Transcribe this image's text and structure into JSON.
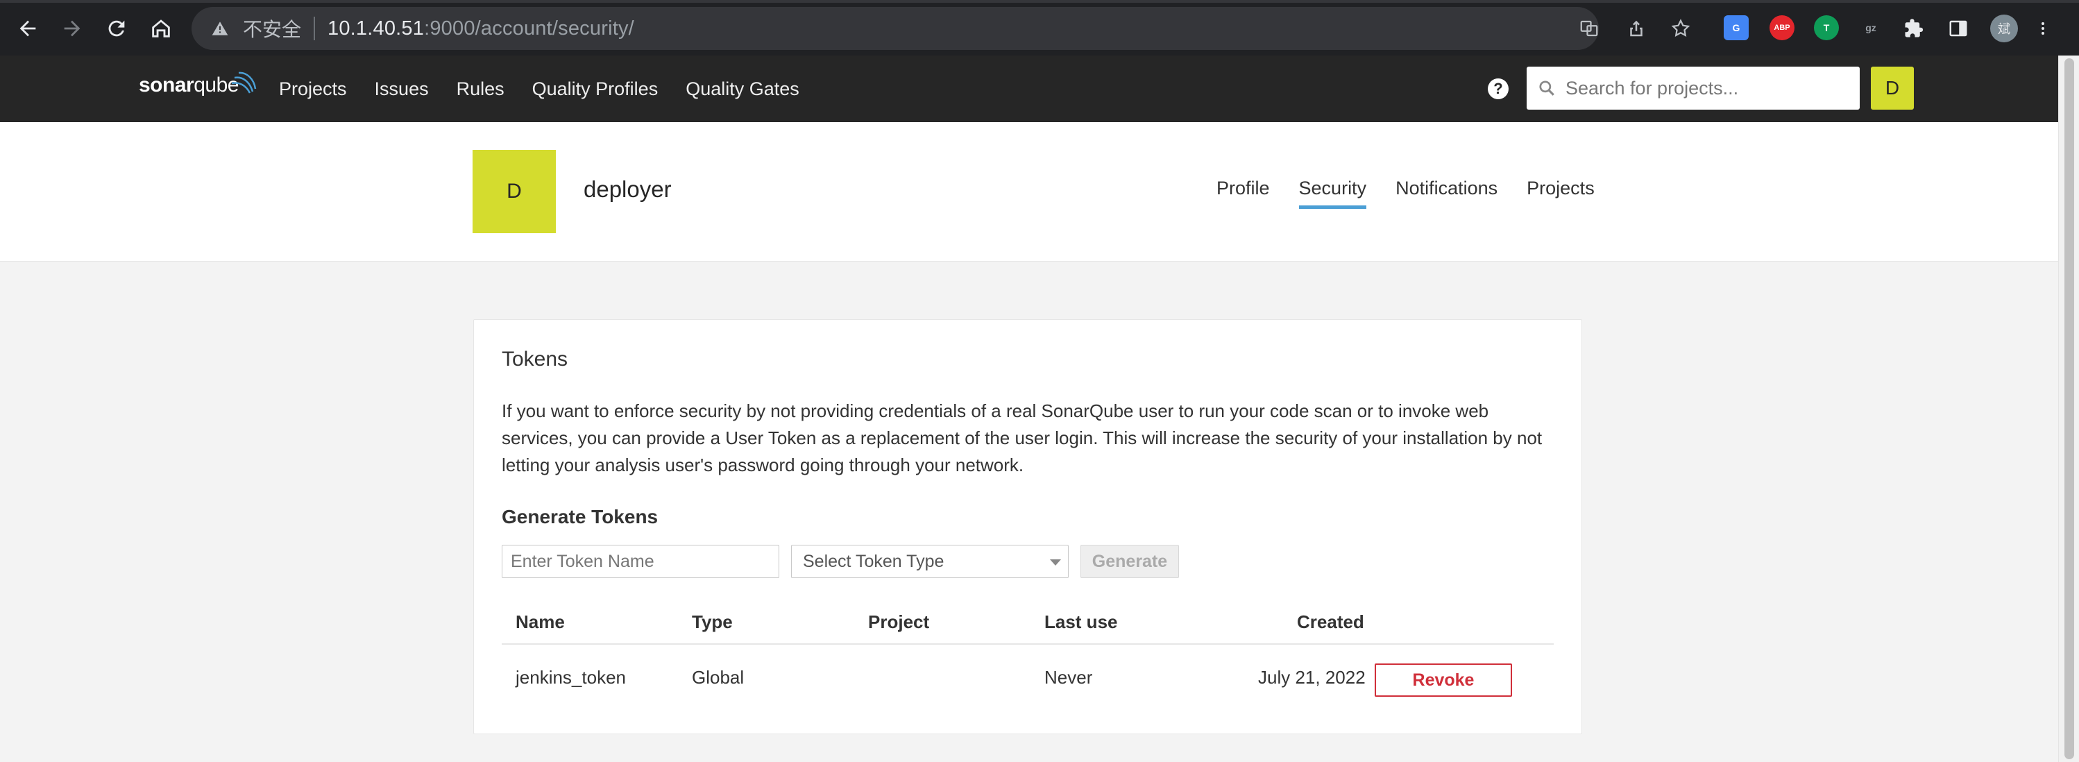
{
  "browser": {
    "insecure_label": "不安全",
    "url_host": "10.1.40.51",
    "url_rest": ":9000/account/security/",
    "profile_initial": "斌",
    "extensions": [
      {
        "name": "google-translate-icon",
        "label": "G",
        "color": "#4285f4"
      },
      {
        "name": "adblock-plus-icon",
        "label": "ABP",
        "color": "#e4262c"
      },
      {
        "name": "tampermonkey-icon",
        "label": "T",
        "color": "#0f9d58"
      },
      {
        "name": "gzip-icon",
        "label": "gz",
        "color": "#5f6368"
      }
    ]
  },
  "nav": {
    "logo_bold": "sonar",
    "logo_light": "qube",
    "menu": [
      "Projects",
      "Issues",
      "Rules",
      "Quality Profiles",
      "Quality Gates"
    ],
    "help_label": "?",
    "search_placeholder": "Search for projects...",
    "user_initial": "D"
  },
  "account": {
    "avatar_initial": "D",
    "username": "deployer",
    "tabs": [
      {
        "label": "Profile",
        "active": false
      },
      {
        "label": "Security",
        "active": true
      },
      {
        "label": "Notifications",
        "active": false
      },
      {
        "label": "Projects",
        "active": false
      }
    ]
  },
  "tokens": {
    "title": "Tokens",
    "description": "If you want to enforce security by not providing credentials of a real SonarQube user to run your code scan or to invoke web services, you can provide a User Token as a replacement of the user login. This will increase the security of your installation by not letting your analysis user's password going through your network.",
    "generate_title": "Generate Tokens",
    "name_placeholder": "Enter Token Name",
    "type_placeholder": "Select Token Type",
    "generate_label": "Generate",
    "columns": {
      "name": "Name",
      "type": "Type",
      "project": "Project",
      "last_use": "Last use",
      "created": "Created"
    },
    "rows": [
      {
        "name": "jenkins_token",
        "type": "Global",
        "project": "",
        "last_use": "Never",
        "created": "July 21, 2022",
        "action": "Revoke"
      }
    ]
  },
  "colors": {
    "nav_bg": "#262626",
    "avatar": "#d4dc2e",
    "active_tab": "#4b9fd5",
    "danger": "#d02f3a"
  }
}
